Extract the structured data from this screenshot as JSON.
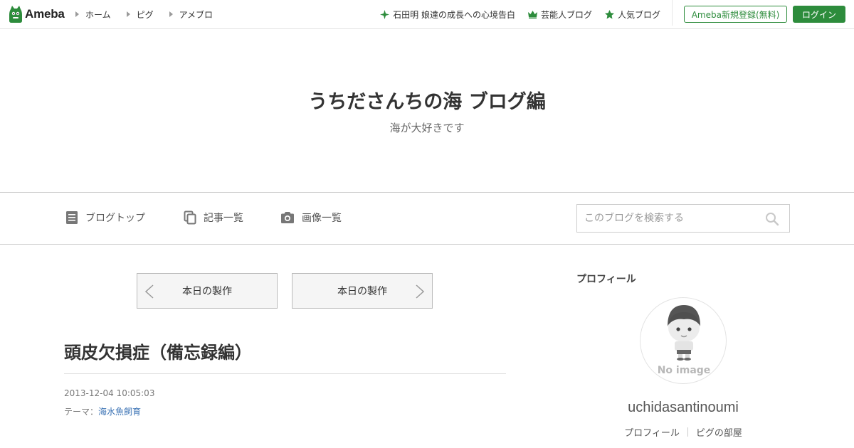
{
  "topbar": {
    "logo_text": "Ameba",
    "nav_left": [
      {
        "label": "ホーム"
      },
      {
        "label": "ピグ"
      },
      {
        "label": "アメブロ"
      }
    ],
    "nav_right": [
      {
        "label": "石田明 娘達の成長への心境告白",
        "icon": "sparkle-icon"
      },
      {
        "label": "芸能人ブログ",
        "icon": "crown-icon"
      },
      {
        "label": "人気ブログ",
        "icon": "star-icon"
      }
    ],
    "register_label": "Ameba新規登録(無料)",
    "login_label": "ログイン",
    "accent_color": "#2d8c3c"
  },
  "blog": {
    "title": "うちださんちの海 ブログ編",
    "description": "海が大好きです"
  },
  "blog_nav": {
    "items": [
      {
        "label": "ブログトップ",
        "icon": "document-icon"
      },
      {
        "label": "記事一覧",
        "icon": "copy-icon"
      },
      {
        "label": "画像一覧",
        "icon": "camera-icon"
      }
    ],
    "search_placeholder": "このブログを検索する"
  },
  "pager": {
    "prev_label": "本日の製作",
    "next_label": "本日の製作"
  },
  "entry": {
    "title": "頭皮欠損症（備忘録編）",
    "date": "2013-12-04 10:05:03",
    "theme_prefix": "テーマ：",
    "theme_label": "海水魚飼育"
  },
  "sidebar": {
    "heading": "プロフィール",
    "avatar_text": "No image",
    "profile_name": "uchidasantinoumi",
    "links": [
      {
        "label": "プロフィール"
      },
      {
        "label": "ピグの部屋"
      }
    ]
  }
}
